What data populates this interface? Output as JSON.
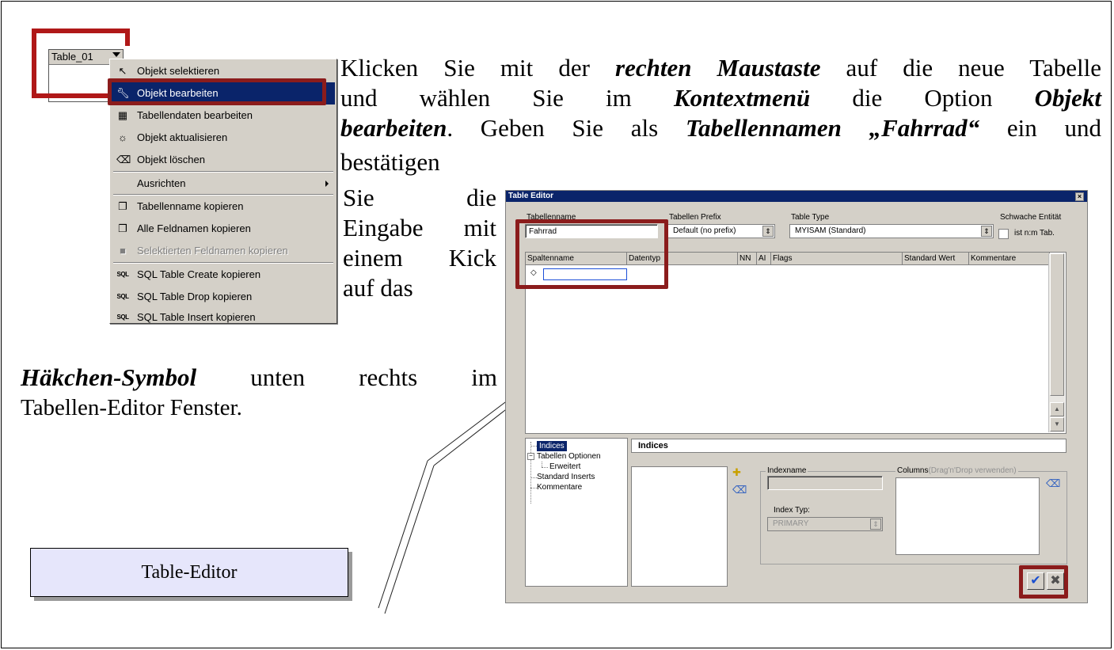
{
  "entity": {
    "title": "Table_01"
  },
  "context_menu": {
    "items": [
      {
        "label": "Objekt selektieren",
        "icon": "cursor-icon"
      },
      {
        "label": "Objekt bearbeiten",
        "icon": "wrench-icon",
        "active": true
      },
      {
        "label": "Tabellendaten bearbeiten",
        "icon": "grid-icon"
      },
      {
        "label": "Objekt aktualisieren",
        "icon": "refresh-icon"
      },
      {
        "label": "Objekt löschen",
        "icon": "eraser-icon"
      },
      {
        "label": "Ausrichten",
        "submenu": true
      },
      {
        "label": "Tabellenname kopieren",
        "icon": "copy-icon"
      },
      {
        "label": "Alle Feldnamen kopieren",
        "icon": "copy-icon"
      },
      {
        "label": "Selektierten Feldnamen kopieren",
        "icon": "copy-icon",
        "disabled": true
      },
      {
        "label": "SQL Table Create kopieren",
        "icon": "sql-icon"
      },
      {
        "label": "SQL Table Drop kopieren",
        "icon": "sql-icon"
      },
      {
        "label": "SQL Table Insert kopieren",
        "icon": "sql-icon"
      }
    ],
    "sql_icon_text": "SQL"
  },
  "instructions": {
    "line1_pre": "Klicken Sie mit der ",
    "line1_em": "rechten Maustaste",
    "line1_post": " auf die neue Tabelle",
    "line2_pre": "und wählen Sie im ",
    "line2_em1": "Kontextmenü",
    "line2_mid": " die Option ",
    "line2_em2": "Objekt",
    "line3_em": "bearbeiten",
    "line3_mid": ". Geben Sie als ",
    "line3_em2": "Tabellennamen",
    "line3_em3": "„Fahrrad“",
    "line3_post": " ein und",
    "line4": "bestätigen",
    "col_words": [
      "Sie die",
      "Eingabe mit",
      "einem Kick",
      "auf das"
    ],
    "line9_em": "Häkchen-Symbol",
    "line9_post": " unten rechts im",
    "line10": "Tabellen-Editor Fenster."
  },
  "caption": "Table-Editor",
  "table_editor": {
    "title": "Table Editor",
    "close_glyph": "×",
    "table_name_label": "Tabellenname",
    "table_name_value": "Fahrrad",
    "prefix_label": "Tabellen Prefix",
    "prefix_value": "Default (no prefix)",
    "type_label": "Table Type",
    "type_value": "MYISAM  (Standard)",
    "weak_entity_label": "Schwache Entität",
    "nm_label": "ist n:m Tab.",
    "columns": [
      "Spaltenname",
      "Datentyp",
      "NN",
      "AI",
      "Flags",
      "Standard Wert",
      "Kommentare"
    ],
    "tree": [
      "Indices",
      "Tabellen Optionen",
      "Erweitert",
      "Standard Inserts",
      "Kommentare"
    ],
    "panel_title": "Indices",
    "indexname_label": "Indexname",
    "columns_group_label": "Columns",
    "columns_hint": "(Drag'n'Drop verwenden)",
    "index_type_label": "Index Typ:",
    "index_type_value": "PRIMARY",
    "ok_glyph": "✔",
    "cancel_glyph": "✖",
    "accent_color": "#0a246a"
  },
  "highlight_color": "#8b1c1c"
}
